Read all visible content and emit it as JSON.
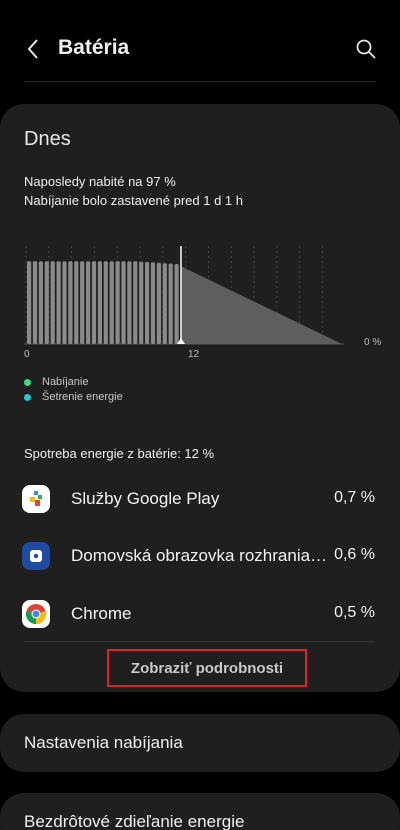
{
  "header": {
    "title": "Batéria"
  },
  "today": {
    "title": "Dnes",
    "last_charged": "Naposledy nabité na 97 %",
    "charging_stopped": "Nabíjanie bolo zastavené pred 1 d 1 h"
  },
  "chart_data": {
    "type": "bar",
    "x_ticks": [
      "0",
      "12"
    ],
    "y_right_label": "0 %",
    "charge_level_until_now": 0.92,
    "projection_end_level": 0
  },
  "legend": [
    {
      "label": "Nabíjanie",
      "color": "#3ddc84"
    },
    {
      "label": "Šetrenie energie",
      "color": "#25c7d9"
    }
  ],
  "usage": {
    "title": "Spotreba energie z batérie: 12 %",
    "apps": [
      {
        "name": "Služby Google Play",
        "value": "0,7 %",
        "icon": "google-play-services-icon"
      },
      {
        "name": "Domovská obrazovka rozhrania One UI",
        "value": "0,6 %",
        "icon": "one-ui-home-icon"
      },
      {
        "name": "Chrome",
        "value": "0,5 %",
        "icon": "chrome-icon"
      }
    ],
    "details_button": "Zobraziť podrobnosti"
  },
  "settings": {
    "charging_settings": "Nastavenia nabíjania",
    "wireless_share": "Bezdrôtové zdieľanie energie"
  }
}
